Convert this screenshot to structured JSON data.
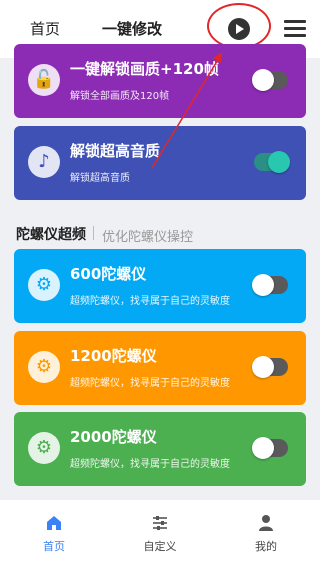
{
  "header": {
    "tabs": [
      {
        "label": "首页"
      },
      {
        "label": "一键修改"
      }
    ]
  },
  "cards": [
    {
      "title": "一键解锁画质+120帧",
      "subtitle": "解锁全部画质及120帧",
      "color": "#8c2bb3",
      "icon": "lock-open-icon",
      "toggle": "off"
    },
    {
      "title": "解锁超高音质",
      "subtitle": "解锁超高音质",
      "color": "#3f51b5",
      "icon": "music-note-icon",
      "toggle": "on"
    },
    {
      "title": "600陀螺仪",
      "subtitle": "超频陀螺仪，找寻属于自己的灵敏度",
      "color": "#03a9f4",
      "icon": "gear-icon",
      "toggle": "off"
    },
    {
      "title": "1200陀螺仪",
      "subtitle": "超频陀螺仪，找寻属于自己的灵敏度",
      "color": "#ff9800",
      "icon": "gear-icon",
      "toggle": "off"
    },
    {
      "title": "2000陀螺仪",
      "subtitle": "超频陀螺仪，找寻属于自己的灵敏度",
      "color": "#4caf50",
      "icon": "gear-icon",
      "toggle": "off"
    }
  ],
  "section": {
    "title": "陀螺仪超频",
    "subtitle": "优化陀螺仪操控"
  },
  "bottom_nav": [
    {
      "label": "首页",
      "icon": "home-icon",
      "active": true
    },
    {
      "label": "自定义",
      "icon": "sliders-icon",
      "active": false
    },
    {
      "label": "我的",
      "icon": "user-icon",
      "active": false
    }
  ],
  "colors": {
    "accent": "#3b82f6",
    "annotation": "#e02828"
  }
}
